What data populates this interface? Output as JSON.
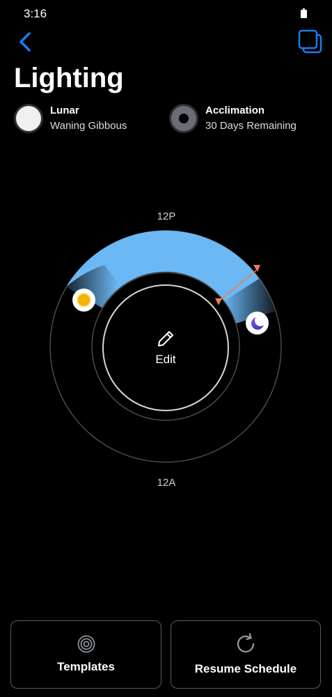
{
  "status_bar": {
    "time": "3:16",
    "battery_icon": "battery-icon"
  },
  "header": {
    "back_icon": "chevron-left-icon",
    "devices_icon": "stacked-squares-icon",
    "title": "Lighting"
  },
  "info": {
    "lunar": {
      "label": "Lunar",
      "value": "Waning Gibbous",
      "icon": "full-moon-icon"
    },
    "acclimation": {
      "label": "Acclimation",
      "value": "30 Days Remaining",
      "icon": "acclimation-icon"
    }
  },
  "dial": {
    "top_label": "12P",
    "bottom_label": "12A",
    "edit_label": "Edit",
    "edit_icon": "pencil-icon",
    "sun_icon": "sun-icon",
    "moon_icon": "crescent-moon-icon",
    "arc_color": "#6cb8f5",
    "marker_color": "#f07a50"
  },
  "bottom_buttons": {
    "templates_label": "Templates",
    "templates_icon": "target-icon",
    "resume_label": "Resume Schedule",
    "resume_icon": "refresh-icon"
  },
  "colors": {
    "background": "#000000",
    "accent": "#1a7cf0"
  }
}
